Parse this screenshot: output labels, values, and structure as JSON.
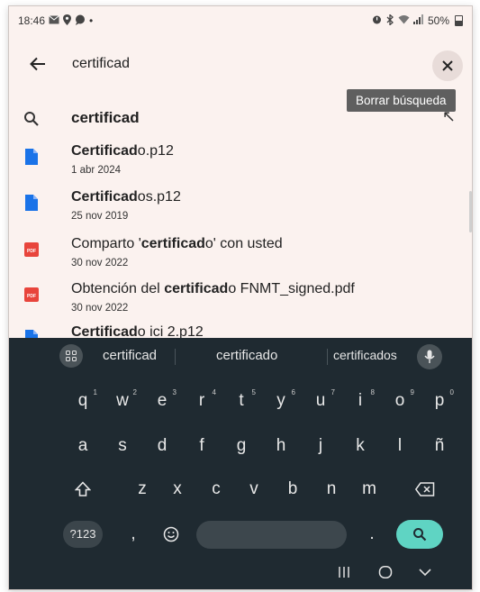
{
  "status": {
    "time": "18:46",
    "left_icons": [
      "mail-icon",
      "location-icon",
      "chat-icon"
    ],
    "dot": "•",
    "battery": "50%"
  },
  "search": {
    "query": "certificad",
    "clear_tooltip": "Borrar búsqueda"
  },
  "suggestion": {
    "text": "certificad"
  },
  "results": [
    {
      "type": "file",
      "bold": "Certificad",
      "rest": "o.p12",
      "prefix": "",
      "date": "1 abr 2024"
    },
    {
      "type": "file",
      "bold": "Certificad",
      "rest": "os.p12",
      "prefix": "",
      "date": "25 nov 2019"
    },
    {
      "type": "pdf",
      "prefix": "Comparto '",
      "bold": "certificad",
      "rest": "o' con usted",
      "date": "30 nov 2022"
    },
    {
      "type": "pdf",
      "prefix": "Obtención del ",
      "bold": "certificad",
      "rest": "o FNMT_signed.pdf",
      "date": "30 nov 2022"
    },
    {
      "type": "file",
      "prefix": "",
      "bold": "Certificad",
      "rest": "o ici 2.p12",
      "date": ""
    }
  ],
  "keyboard": {
    "suggestions": [
      "certificad",
      "certificado",
      "certificados"
    ],
    "row1": [
      {
        "k": "q",
        "n": "1"
      },
      {
        "k": "w",
        "n": "2"
      },
      {
        "k": "e",
        "n": "3"
      },
      {
        "k": "r",
        "n": "4"
      },
      {
        "k": "t",
        "n": "5"
      },
      {
        "k": "y",
        "n": "6"
      },
      {
        "k": "u",
        "n": "7"
      },
      {
        "k": "i",
        "n": "8"
      },
      {
        "k": "o",
        "n": "9"
      },
      {
        "k": "p",
        "n": "0"
      }
    ],
    "row2": [
      "a",
      "s",
      "d",
      "f",
      "g",
      "h",
      "j",
      "k",
      "l",
      "ñ"
    ],
    "row3": [
      "z",
      "x",
      "c",
      "v",
      "b",
      "n",
      "m"
    ],
    "symbols_label": "?123",
    "comma": ",",
    "period": "."
  },
  "colors": {
    "accent": "#5fd4c3",
    "file_icon": "#1a73e8",
    "pdf_icon": "#e8453c"
  }
}
